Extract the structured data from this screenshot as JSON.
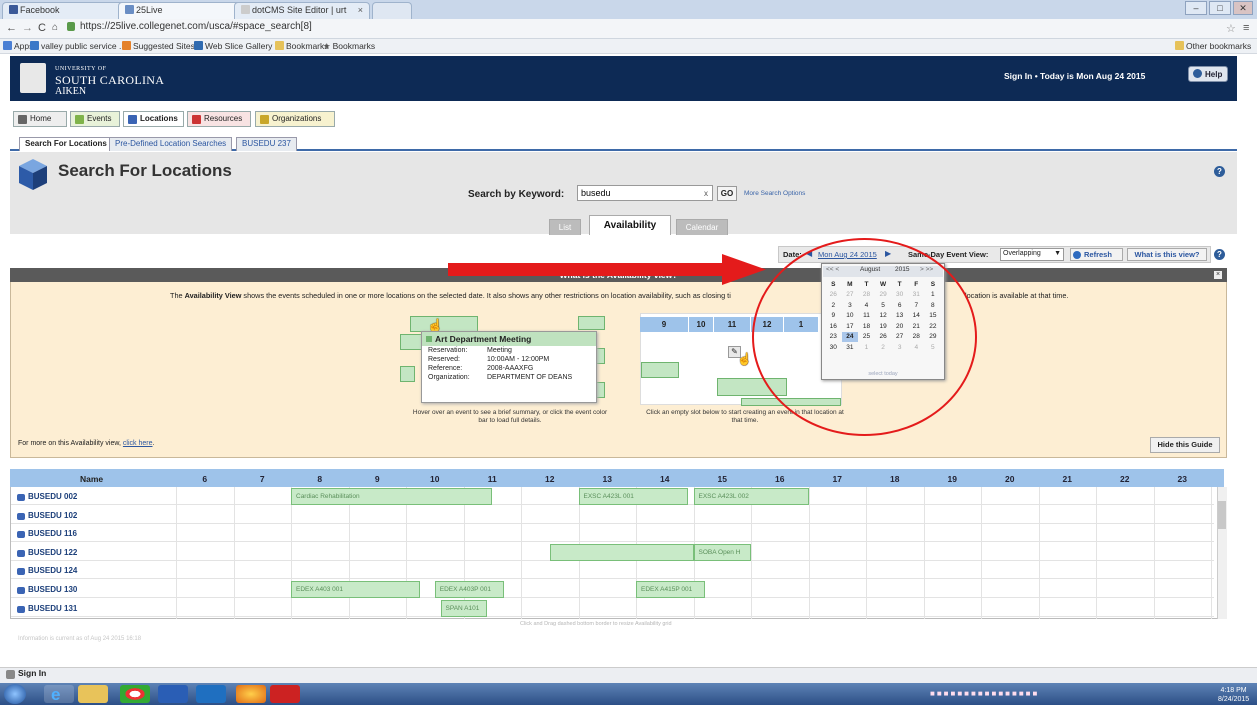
{
  "browser": {
    "tabs": [
      "Facebook",
      "25Live",
      "dotCMS Site Editor | urt"
    ],
    "url": "https://25live.collegenet.com/usca/#space_search[8]",
    "bookmarks": [
      "Apps",
      "valley public service ...",
      "Suggested Sites",
      "Web Slice Gallery",
      "Bookmarks",
      "Bookmarks"
    ],
    "other_bookmarks": "Other bookmarks",
    "window_buttons": [
      "–",
      "□",
      "✕"
    ]
  },
  "header": {
    "univ_line1": "UNIVERSITY OF",
    "univ_line2": "SOUTH CAROLINA",
    "univ_line3": "AIKEN",
    "signin_text": "Sign In  •  Today is Mon Aug 24 2015",
    "help": "Help"
  },
  "nav": {
    "tabs": [
      "Home",
      "Events",
      "Locations",
      "Resources",
      "Organizations"
    ],
    "subtabs": [
      "Search For Locations",
      "Pre-Defined Location Searches",
      "BUSEDU 237"
    ]
  },
  "search": {
    "title": "Search For Locations",
    "keyword_label": "Search by Keyword:",
    "keyword_value": "busedu",
    "clear": "x",
    "go": "GO",
    "more_options": "More Search Options",
    "view_tabs": [
      "List",
      "Availability",
      "Calendar"
    ]
  },
  "datebar": {
    "date_label": "Date:",
    "date_value": "Mon Aug 24 2015",
    "sameday_label": "Same-Day Event View:",
    "sameday_value": "Overlapping",
    "refresh": "Refresh",
    "what_view": "What is this view?"
  },
  "guide": {
    "header": "What is the Availability view?",
    "text_pre": "The ",
    "text_bold": "Availability View",
    "text_post": " shows the events scheduled in one or more locations on the selected date. It also shows any other restrictions on location availability, such as closing ti",
    "text_right": "location is available at that time.",
    "popup_title": "Art Department Meeting",
    "popup_rows": [
      {
        "k": "Reservation:",
        "v": "Meeting"
      },
      {
        "k": "Reserved:",
        "v": "10:00AM - 12:00PM"
      },
      {
        "k": "Reference:",
        "v": "2008-AAAXFG"
      },
      {
        "k": "Organization:",
        "v": "DEPARTMENT OF DEANS"
      }
    ],
    "caption_left": "Hover over an event to see a brief summary, or click the event color bar to load full details.",
    "caption_right": "Click an empty slot below to start creating an event in that location at that time.",
    "illus_hours": [
      "9",
      "10",
      "11",
      "12",
      "1"
    ],
    "for_more": "For more on this Availability view, ",
    "click_here": "click here",
    "hide": "Hide this Guide"
  },
  "calendar": {
    "month": "August",
    "year": "2015",
    "prev": "<< <",
    "next": "> >>",
    "dow": [
      "S",
      "M",
      "T",
      "W",
      "T",
      "F",
      "S"
    ],
    "weeks": [
      [
        "26",
        "27",
        "28",
        "29",
        "30",
        "31",
        "1"
      ],
      [
        "2",
        "3",
        "4",
        "5",
        "6",
        "7",
        "8"
      ],
      [
        "9",
        "10",
        "11",
        "12",
        "13",
        "14",
        "15"
      ],
      [
        "16",
        "17",
        "18",
        "19",
        "20",
        "21",
        "22"
      ],
      [
        "23",
        "24",
        "25",
        "26",
        "27",
        "28",
        "29"
      ],
      [
        "30",
        "31",
        "1",
        "2",
        "3",
        "4",
        "5"
      ]
    ],
    "selected": "24",
    "footer": "select today"
  },
  "grid": {
    "name_header": "Name",
    "hours": [
      "6",
      "7",
      "8",
      "9",
      "10",
      "11",
      "12",
      "13",
      "14",
      "15",
      "16",
      "17",
      "18",
      "19",
      "20",
      "21",
      "22",
      "23"
    ],
    "rows": [
      "BUSEDU 002",
      "BUSEDU 102",
      "BUSEDU 116",
      "BUSEDU 122",
      "BUSEDU 124",
      "BUSEDU 130",
      "BUSEDU 131"
    ],
    "events": [
      {
        "row": 0,
        "start": 8,
        "end": 11.5,
        "label": "Cardiac Rehabilitation"
      },
      {
        "row": 0,
        "start": 13,
        "end": 14.9,
        "label": "EXSC A423L 001"
      },
      {
        "row": 0,
        "start": 15,
        "end": 17,
        "label": "EXSC A423L 002"
      },
      {
        "row": 3,
        "start": 12.5,
        "end": 15,
        "label": ""
      },
      {
        "row": 3,
        "start": 15,
        "end": 16,
        "label": "SOBA Open H"
      },
      {
        "row": 5,
        "start": 8,
        "end": 10.25,
        "label": "EDEX A403 001"
      },
      {
        "row": 5,
        "start": 10.5,
        "end": 11.7,
        "label": "EDEX A403P 001"
      },
      {
        "row": 5,
        "start": 14,
        "end": 15.2,
        "label": "EDEX A415P 001"
      },
      {
        "row": 6,
        "start": 10.6,
        "end": 11.4,
        "label": "SPAN A101"
      }
    ],
    "drag_hint": "Click and Drag dashed bottom border to resize Availability grid",
    "info_current": "Information is current as of Aug 24 2015 16:18"
  },
  "status": {
    "signin": "Sign In",
    "clock_time": "4:18 PM",
    "clock_date": "8/24/2015"
  },
  "colors": {
    "navy": "#0d2a55",
    "event_green": "#c8eac8",
    "grid_header_blue": "#9ec3ea",
    "annotation_red": "#e41b1b"
  }
}
